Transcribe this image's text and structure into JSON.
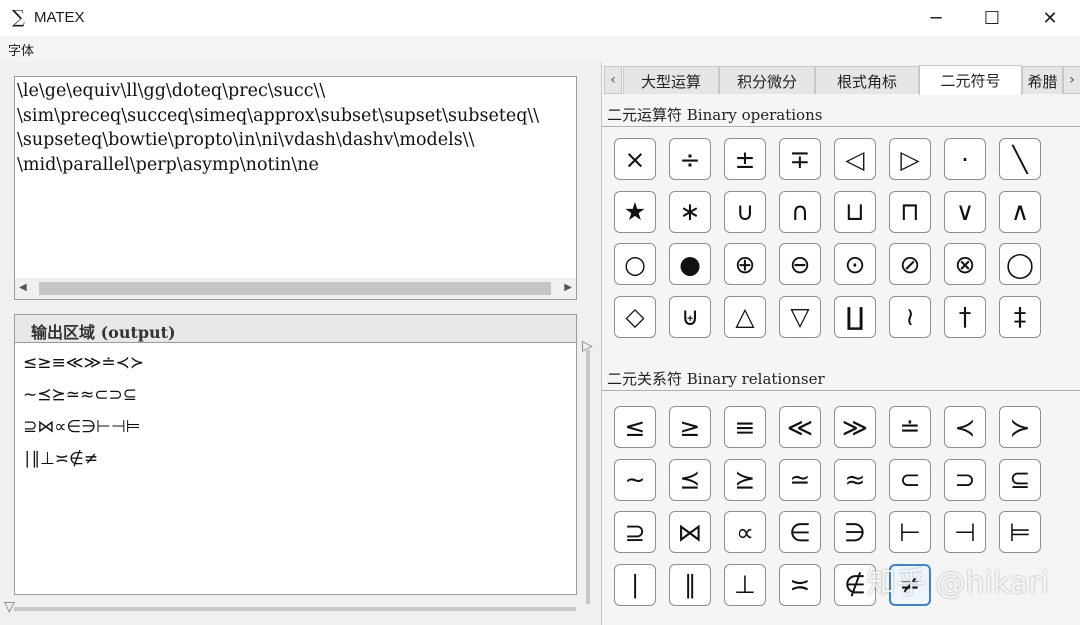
{
  "window": {
    "title": "MATEX",
    "icon_glyph": "∑",
    "minimize": "─",
    "maximize": "☐",
    "close": "✕"
  },
  "menu": {
    "font": "字体"
  },
  "editor": {
    "lines": [
      "\\le\\ge\\equiv\\ll\\gg\\doteq\\prec\\succ\\\\",
      "\\sim\\preceq\\succeq\\simeq\\approx\\subset\\supset\\subseteq\\\\",
      "\\supseteq\\bowtie\\propto\\in\\ni\\vdash\\dashv\\models\\\\",
      "\\mid\\parallel\\perp\\asymp\\notin\\ne"
    ]
  },
  "output": {
    "title": "输出区域 (output)",
    "lines": [
      "≤≥≡≪≫≐≺≻",
      "∼⪯⪰≃≈⊂⊃⊆",
      "⊇⋈∝∈∋⊢⊣⊨",
      "∣∥⊥≍∉≠"
    ]
  },
  "tabs": [
    {
      "label": "大型运算",
      "active": false
    },
    {
      "label": "积分微分",
      "active": false
    },
    {
      "label": "根式角标",
      "active": false
    },
    {
      "label": "二元符号",
      "active": true
    },
    {
      "label": "希腊",
      "active": false
    }
  ],
  "tab_scroll": {
    "left": "‹",
    "right": "›"
  },
  "sections": {
    "operations": {
      "title": "二元运算符 Binary operations",
      "symbols": [
        "×",
        "÷",
        "±",
        "∓",
        "◁",
        "▷",
        "·",
        "╲",
        "★",
        "∗",
        "∪",
        "∩",
        "⊔",
        "⊓",
        "∨",
        "∧",
        "○",
        "●",
        "⊕",
        "⊖",
        "⊙",
        "⊘",
        "⊗",
        "◯",
        "◇",
        "⊎",
        "△",
        "▽",
        "∐",
        "≀",
        "†",
        "‡"
      ]
    },
    "relations": {
      "title": "二元关系符 Binary relationser",
      "symbols": [
        "≤",
        "≥",
        "≡",
        "≪",
        "≫",
        "≐",
        "≺",
        "≻",
        "∼",
        "⪯",
        "⪰",
        "≃",
        "≈",
        "⊂",
        "⊃",
        "⊆",
        "⊇",
        "⋈",
        "∝",
        "∈",
        "∋",
        "⊢",
        "⊣",
        "⊨",
        "∣",
        "∥",
        "⊥",
        "≍",
        "∉",
        "≠"
      ]
    }
  },
  "watermark": "知乎 @hikari",
  "colors": {
    "selected_border": "#3a83d8"
  }
}
